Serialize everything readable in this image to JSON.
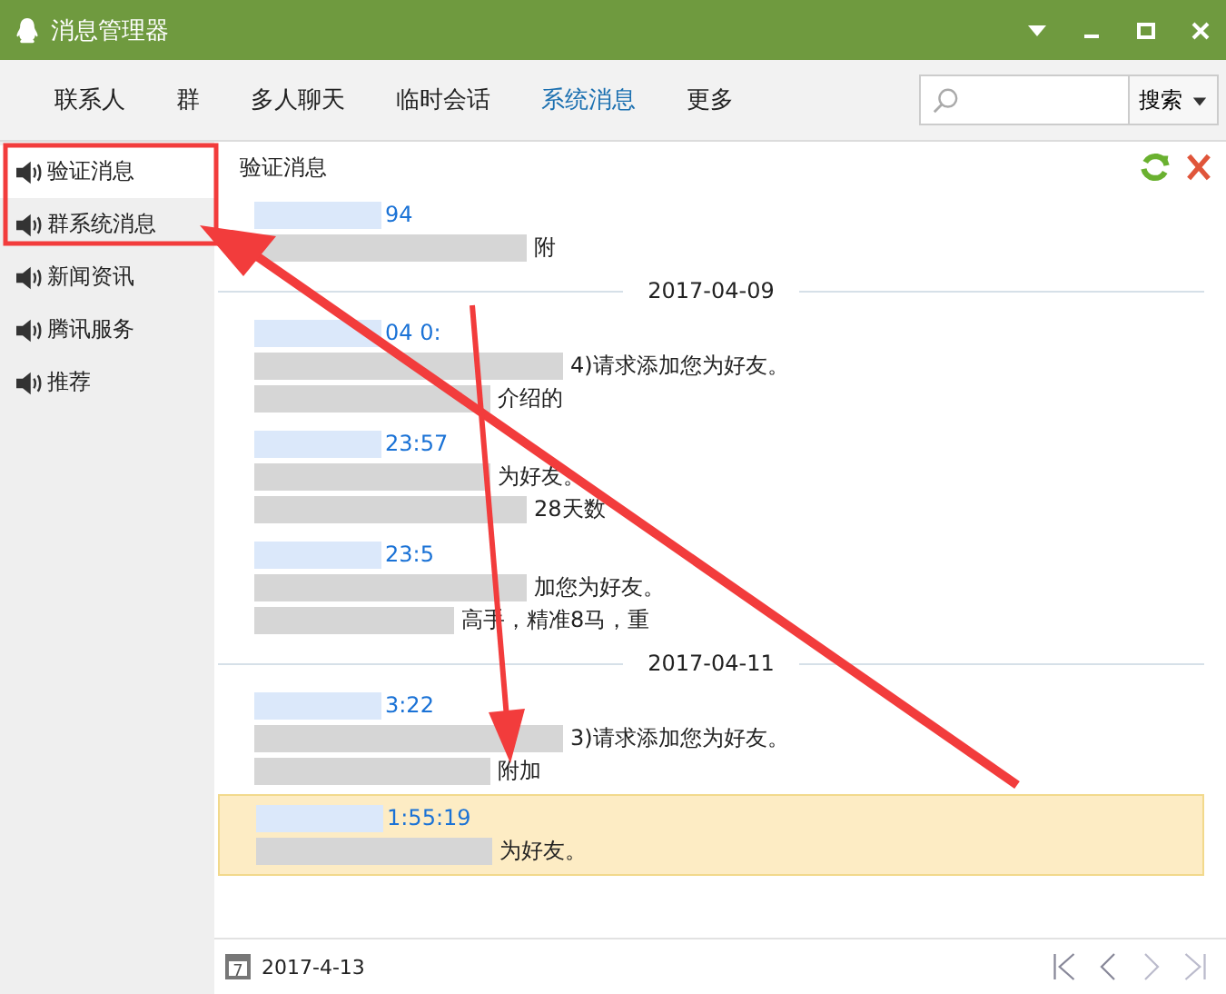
{
  "window": {
    "title": "消息管理器"
  },
  "tabs": [
    {
      "label": "联系人",
      "selected": false
    },
    {
      "label": "群",
      "selected": false
    },
    {
      "label": "多人聊天",
      "selected": false
    },
    {
      "label": "临时会话",
      "selected": false
    },
    {
      "label": "系统消息",
      "selected": true
    },
    {
      "label": "更多",
      "selected": false
    }
  ],
  "search": {
    "button": "搜索"
  },
  "sidebar": {
    "items": [
      {
        "label": "验证消息",
        "selected": true
      },
      {
        "label": "群系统消息",
        "selected": false
      },
      {
        "label": "新闻资讯",
        "selected": false
      },
      {
        "label": "腾讯服务",
        "selected": false
      },
      {
        "label": "推荐",
        "selected": false
      }
    ]
  },
  "panel": {
    "title": "验证消息"
  },
  "messages": [
    {
      "kind": "message",
      "time": "94",
      "lines": [
        "附"
      ],
      "selected": false
    },
    {
      "kind": "date",
      "text": "2017-04-09"
    },
    {
      "kind": "message",
      "time": "04 0:",
      "lines": [
        "4)请求添加您为好友。",
        "介绍的"
      ],
      "selected": false
    },
    {
      "kind": "message",
      "time": "23:57",
      "lines": [
        "为好友。",
        "28天数"
      ],
      "selected": false
    },
    {
      "kind": "message",
      "time": "23:5",
      "lines": [
        "加您为好友。",
        "高手，精准8马，重"
      ],
      "selected": false
    },
    {
      "kind": "date",
      "text": "2017-04-11"
    },
    {
      "kind": "message",
      "time": "3:22",
      "lines": [
        "3)请求添加您为好友。",
        "附加"
      ],
      "selected": false
    },
    {
      "kind": "message",
      "time": "1:55:19",
      "lines": [
        "为好友。"
      ],
      "selected": true
    }
  ],
  "footer": {
    "date": "2017-4-13",
    "calendar_day": "7"
  }
}
